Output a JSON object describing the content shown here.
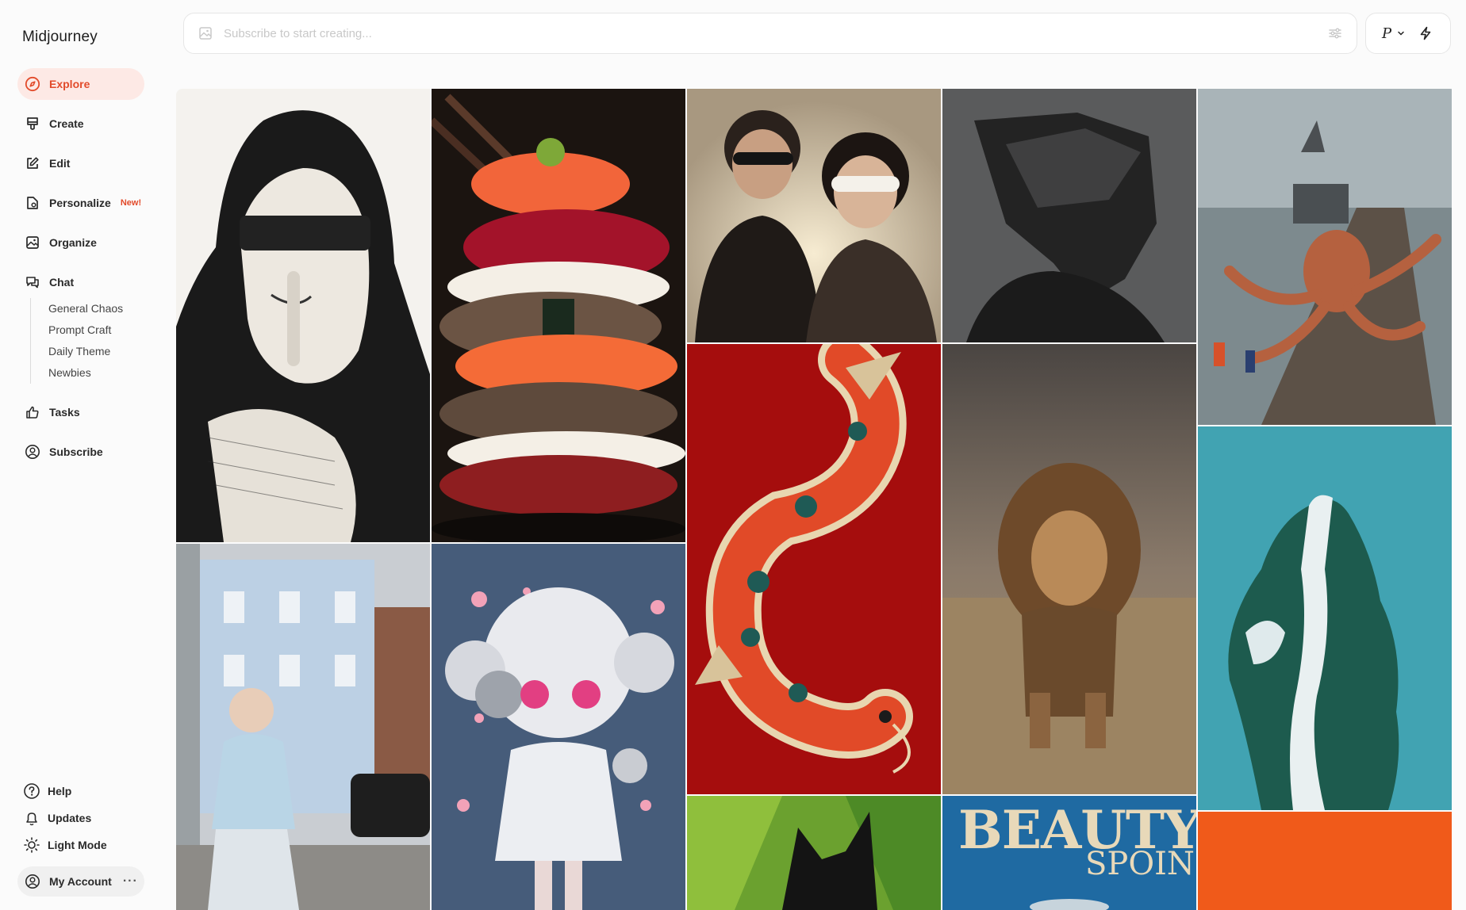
{
  "app": {
    "title": "Midjourney"
  },
  "nav": {
    "explore": "Explore",
    "create": "Create",
    "edit": "Edit",
    "personalize": "Personalize",
    "personalize_badge": "New!",
    "organize": "Organize",
    "chat": "Chat",
    "chat_rooms": [
      "General Chaos",
      "Prompt Craft",
      "Daily Theme",
      "Newbies"
    ],
    "tasks": "Tasks",
    "subscribe": "Subscribe"
  },
  "bottom_nav": {
    "help": "Help",
    "updates": "Updates",
    "light_mode": "Light Mode",
    "account": "My Account",
    "account_more": "···"
  },
  "prompt": {
    "placeholder": "Subscribe to start creating..."
  },
  "mode": {
    "letter": "P"
  },
  "gallery": {
    "beauty_poster_title": "BEAUTY",
    "beauty_poster_subtitle": "SPOIN"
  },
  "colors": {
    "accent": "#e24b2b",
    "accent_bg": "#fde9e5"
  }
}
